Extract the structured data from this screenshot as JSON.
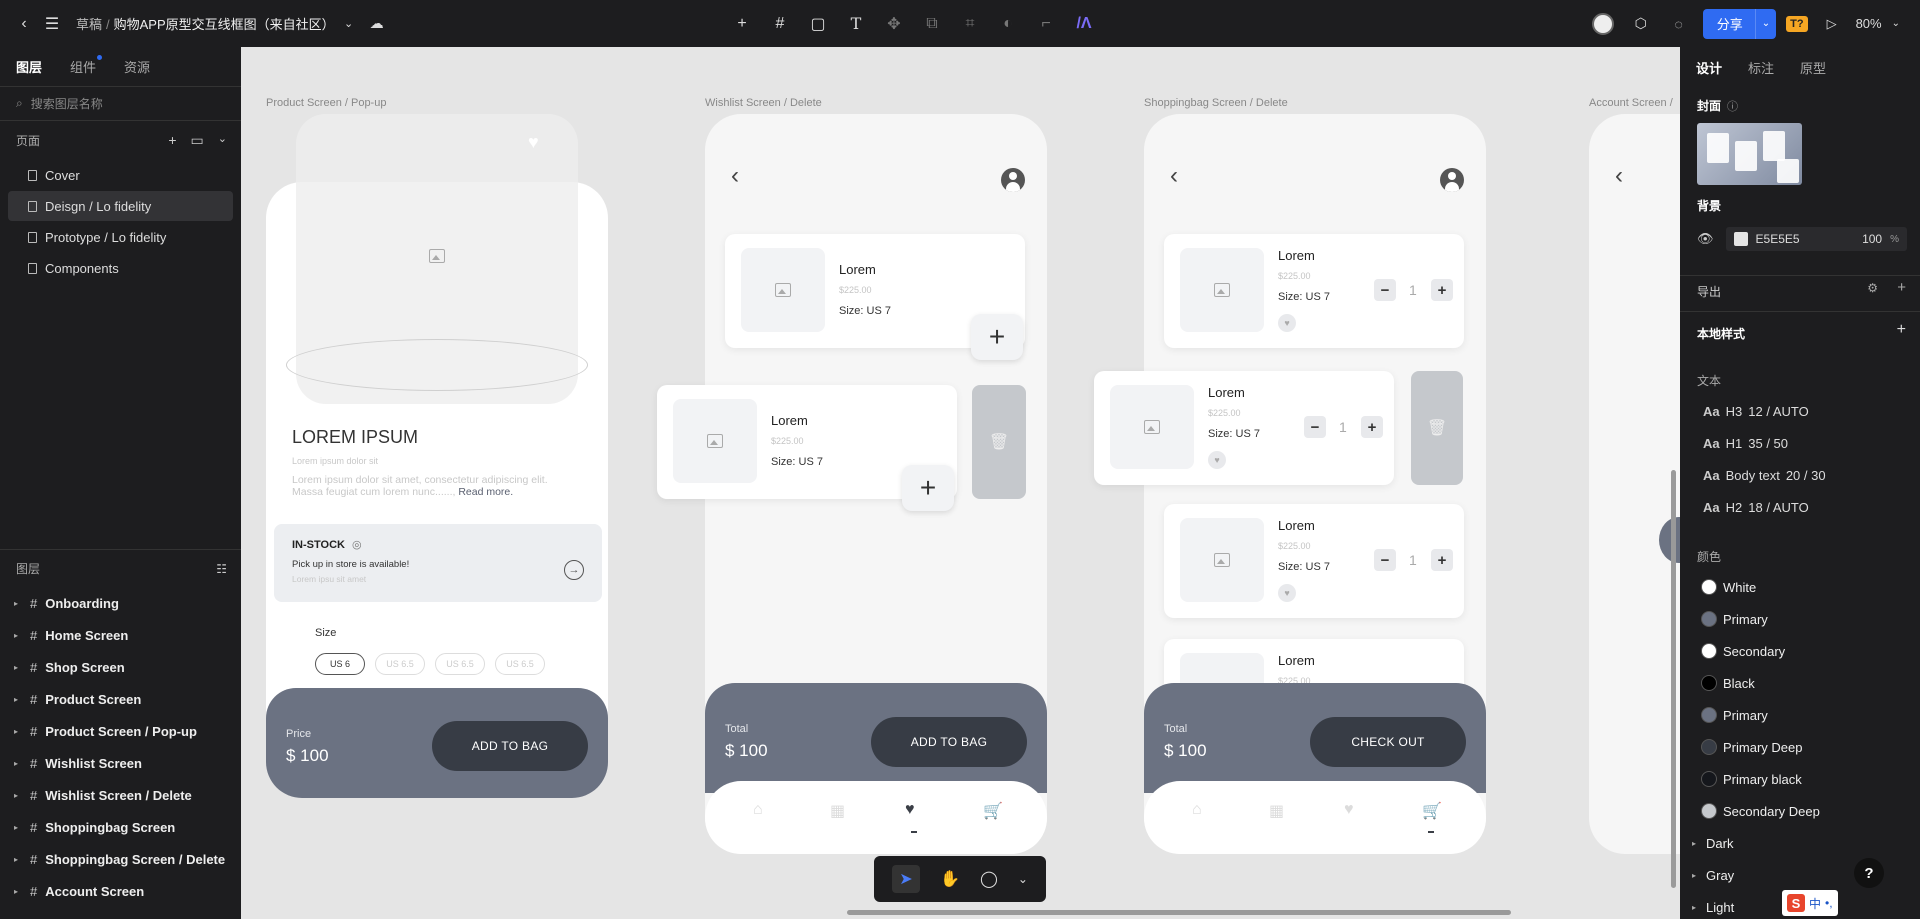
{
  "topbar": {
    "breadcrumb_root": "草稿",
    "breadcrumb_sep": "/",
    "doc_title": "购物APP原型交互线框图（来自社区）",
    "share_label": "分享",
    "zoom": "80%",
    "t_badge": "T?"
  },
  "left": {
    "tabs": [
      "图层",
      "组件",
      "资源"
    ],
    "search_placeholder": "搜索图层名称",
    "pages_title": "页面",
    "pages": [
      "Cover",
      "Deisgn / Lo fidelity",
      "Prototype / Lo fidelity",
      "Components"
    ],
    "layers_title": "图层",
    "layers": [
      "Onboarding",
      "Home Screen",
      "Shop Screen",
      "Product Screen",
      "Product Screen / Pop-up",
      "Wishlist Screen",
      "Wishlist Screen / Delete",
      "Shoppingbag Screen",
      "Shoppingbag Screen / Delete",
      "Account Screen"
    ]
  },
  "right": {
    "tabs": [
      "设计",
      "标注",
      "原型"
    ],
    "cover_label": "封面",
    "bg_label": "背景",
    "bg_hex": "E5E5E5",
    "bg_opacity": "100",
    "bg_unit": "%",
    "export_label": "导出",
    "local_styles": "本地样式",
    "text_label": "文本",
    "text_styles": [
      {
        "aa": "Aa",
        "name": "H3",
        "spec": "12 / AUTO"
      },
      {
        "aa": "Aa",
        "name": "H1",
        "spec": "35 / 50"
      },
      {
        "aa": "Aa",
        "name": "Body text",
        "spec": "20 / 30"
      },
      {
        "aa": "Aa",
        "name": "H2",
        "spec": "18 / AUTO"
      }
    ],
    "color_label": "颜色",
    "colors": [
      {
        "name": "White",
        "hex": "#ffffff"
      },
      {
        "name": "Primary",
        "hex": "#6b7282"
      },
      {
        "name": "Secondary",
        "hex": "#ffffff"
      },
      {
        "name": "Black",
        "hex": "#000000"
      },
      {
        "name": "Primary",
        "hex": "#6b7282"
      },
      {
        "name": "Primary Deep",
        "hex": "#373c45"
      },
      {
        "name": "Primary black",
        "hex": "#15171c"
      },
      {
        "name": "Secondary Deep",
        "hex": "#c5c8cc"
      }
    ],
    "groups": [
      "Dark",
      "Gray",
      "Light"
    ],
    "help": "?"
  },
  "ime": {
    "logo": "S",
    "lang": "中",
    "extra": "•,"
  },
  "canvas": {
    "frame_labels": [
      "Product Screen / Pop-up",
      "Wishlist Screen / Delete",
      "Shoppingbag Screen / Delete",
      "Account Screen /"
    ],
    "product": {
      "title": "LOREM IPSUM",
      "subtitle": "Lorem ipsum dolor sit",
      "desc1": "Lorem ipsum dolor sit amet, consectetur adipiscing elit.",
      "desc2": "Massa feugiat cum lorem nunc......,",
      "read_more": "Read more.",
      "stock_title": "IN-STOCK",
      "stock_sub": "Pick up in store is available!",
      "stock_sub2": "Lorem ipsu sit amet",
      "size_label": "Size",
      "sizes": [
        "US 6",
        "US 6.5",
        "US 6.5",
        "US 6.5"
      ],
      "price_label": "Price",
      "price": "$ 100",
      "cta": "ADD TO BAG"
    },
    "item": {
      "name": "Lorem",
      "price": "$225.00",
      "size": "Size: US 7",
      "qty": "1"
    },
    "wishlist": {
      "total_label": "Total",
      "total": "$ 100",
      "cta": "ADD TO BAG"
    },
    "bag": {
      "total_label": "Total",
      "total": "$ 100",
      "cta": "CHECK OUT"
    }
  }
}
